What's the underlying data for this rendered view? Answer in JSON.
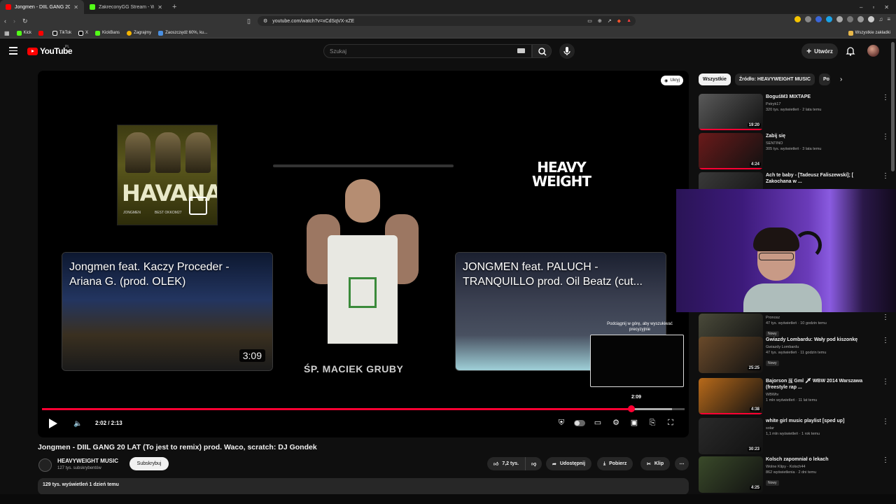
{
  "browser": {
    "tabs": [
      {
        "title": "Jongmen - DIIL GANG 20 LAT (T...",
        "active": true,
        "fav_color": "#ff0000"
      },
      {
        "title": "ZakreconyGG Stream - Watch Live o...",
        "active": false,
        "fav_color": "#53fc18"
      }
    ],
    "url": "youtube.com/watch?v=xCdSqVX-xZE",
    "bookmarks": [
      {
        "label": "Kick",
        "color": "#53fc18"
      },
      {
        "label": "",
        "color": "#ff0000"
      },
      {
        "label": "TikTok",
        "color": "#ffffff"
      },
      {
        "label": "X",
        "color": "#ffffff"
      },
      {
        "label": "KickBans",
        "color": "#53fc18"
      },
      {
        "label": "Zagrajmy",
        "color": "#f4b400"
      },
      {
        "label": "Zaoszczędź 60%, ku...",
        "color": "#4a90e2"
      }
    ],
    "all_bookmarks": "Wszystkie zakładki"
  },
  "youtube": {
    "logo": "YouTube",
    "country": "PL",
    "search_placeholder": "Szukaj",
    "create_label": "Utwórz"
  },
  "player": {
    "hide_label": "Ukryj",
    "cover": {
      "title": "HAVANA",
      "artist": "JONGMEN",
      "subtitle": "BEST OKKOM27"
    },
    "memorial": "ŚP. MACIEK GRUBY",
    "brand_logo": [
      "HEAVY",
      "WEIGHT"
    ],
    "endcards": [
      {
        "title": "Jongmen feat. Kaczy Proceder - Ariana G. (prod. OLEK)",
        "duration": "3:09"
      },
      {
        "title": "JONGMEN feat. PALUCH - TRANQUILLO prod. Oil Beatz (cut...",
        "duration": ""
      }
    ],
    "pip_hint": "Podciągnij w górę, aby wyszukiwać precyzyjnie",
    "pip_time": "2:09",
    "time_display": "2:02 / 2:13",
    "progress": {
      "played_fraction": 0.917,
      "loaded_fraction": 0.98
    }
  },
  "video": {
    "title": "Jongmen - DIIL GANG 20 LAT (To jest to remix) prod. Waco, scratch: DJ Gondek",
    "channel": "HEAVYWEIGHT MUSIC",
    "subscribers": "127 tys. subskrybentów",
    "subscribe_label": "Subskrybuj",
    "likes": "7,2 tys.",
    "share_label": "Udostępnij",
    "download_label": "Pobierz",
    "clip_label": "Klip",
    "stats": "129 tys. wyświetleń  1 dzień temu"
  },
  "sidebar": {
    "chips": [
      {
        "label": "Wszystkie",
        "active": true
      },
      {
        "label": "Źródło: HEAVYWEIGHT MUSIC",
        "active": false
      },
      {
        "label": "Po",
        "active": false
      }
    ],
    "items": [
      {
        "title": "BoguśM3 MIXTAPE",
        "channel": "Pstryk17",
        "meta": "320 tys. wyświetleń · 2 lata temu",
        "duration": "19:20",
        "badge": "",
        "progress": 1.0,
        "thumb": "#5a5a5a"
      },
      {
        "title": "Zabij się",
        "channel": "SENTINO",
        "meta": "305 tys. wyświetleń · 3 lata temu",
        "duration": "4:24",
        "badge": "",
        "progress": 1.0,
        "thumb": "#6a1a1a"
      },
      {
        "title": "Ach te baby - [Tadeusz Faliszewski]; [ Zakochana w ...",
        "channel": "",
        "meta": "",
        "duration": "",
        "badge": "",
        "progress": 0,
        "thumb": "#3a3a3a"
      },
      {
        "title": "",
        "channel": "Pronosz",
        "meta": "47 tys. wyświetleń · 10 godzin temu",
        "duration": "21:13",
        "badge": "Nowy",
        "progress": 0,
        "thumb": "#4a4a3a"
      },
      {
        "title": "Gwiazdy Lombardu: Wały pod kiszonkę",
        "channel": "Gwiazdy Lombardu",
        "meta": "47 tys. wyświetleń · 11 godzin temu",
        "duration": "25:25",
        "badge": "Nowy",
        "progress": 0,
        "thumb": "#6a4a2a"
      },
      {
        "title": "Bajorson 🇳 Gml 🗡 WBW 2014 Warszawa (freestyle rap ...",
        "channel": "WBWtv",
        "meta": "1 mln wyświetleń · 11 lat temu",
        "duration": "4:38",
        "badge": "",
        "progress": 1.0,
        "thumb": "#b86a1a"
      },
      {
        "title": "white girl music playlist [sped up]",
        "channel": "solar",
        "meta": "1,1 mln wyświetleń · 1 rok temu",
        "duration": "30:23",
        "badge": "",
        "progress": 0,
        "thumb": "#2a2a2a"
      },
      {
        "title": "Kolsch zapomniał o lekach",
        "channel": "Wolne Klipy - Kolsch44",
        "meta": "862 wyświetlenia · 2 dni temu",
        "duration": "4:25",
        "badge": "Nowy",
        "progress": 0,
        "thumb": "#3a4a2a"
      }
    ]
  },
  "colors": {
    "accent": "#ff0033",
    "background": "#0f0f0f",
    "webcam_light": "#8a5be0"
  }
}
